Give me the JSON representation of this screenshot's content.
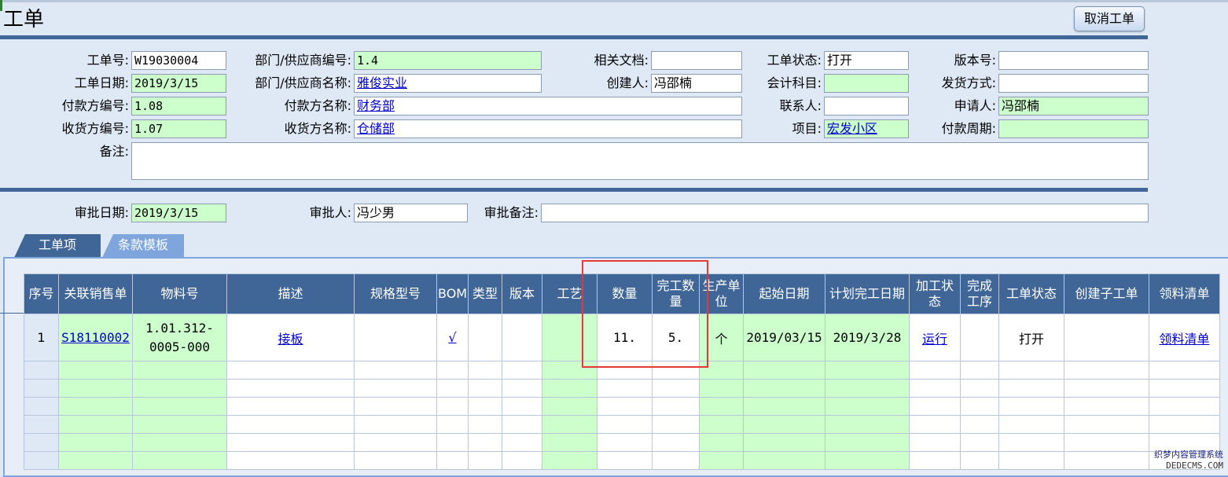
{
  "title": "工单",
  "cancel_button": "取消工单",
  "form": {
    "order_no": {
      "label": "工单号:",
      "value": "W19030004"
    },
    "order_date": {
      "label": "工单日期:",
      "value": "2019/3/15"
    },
    "payer_code": {
      "label": "付款方编号:",
      "value": "1.08"
    },
    "receiver_code": {
      "label": "收货方编号:",
      "value": "1.07"
    },
    "remarks": {
      "label": "备注:",
      "value": ""
    },
    "dept_code": {
      "label": "部门/供应商编号:",
      "value": "1.4"
    },
    "dept_name": {
      "label": "部门/供应商名称:",
      "value": "雅俊实业"
    },
    "payer_name": {
      "label": "付款方名称:",
      "value": "财务部"
    },
    "receiver_name": {
      "label": "收货方名称:",
      "value": "仓储部"
    },
    "related_docs": {
      "label": "相关文档:",
      "value": ""
    },
    "creator": {
      "label": "创建人:",
      "value": "冯邵楠"
    },
    "status": {
      "label": "工单状态:",
      "value": "打开"
    },
    "account": {
      "label": "会计科目:",
      "value": ""
    },
    "contact": {
      "label": "联系人:",
      "value": ""
    },
    "project": {
      "label": "项目:",
      "value": "宏发小区"
    },
    "version": {
      "label": "版本号:",
      "value": ""
    },
    "shipping": {
      "label": "发货方式:",
      "value": ""
    },
    "applicant": {
      "label": "申请人:",
      "value": "冯邵楠"
    },
    "pay_period": {
      "label": "付款周期:",
      "value": ""
    }
  },
  "approval": {
    "date": {
      "label": "审批日期:",
      "value": "2019/3/15"
    },
    "approver": {
      "label": "审批人:",
      "value": "冯少男"
    },
    "note": {
      "label": "审批备注:",
      "value": ""
    }
  },
  "tabs": [
    "工单项",
    "条款模板"
  ],
  "grid": {
    "headers": [
      "序号",
      "关联销售单",
      "物料号",
      "描述",
      "规格型号",
      "BOM",
      "类型",
      "版本",
      "工艺",
      "数量",
      "完工数量",
      "生产单位",
      "起始日期",
      "计划完工日期",
      "加工状态",
      "完成工序",
      "工单状态",
      "创建子工单",
      "领料清单"
    ],
    "row": {
      "seq": "1",
      "sales_order": "S18110002",
      "material": "1.01.312-0005-000",
      "description": "接板",
      "spec": "",
      "bom": "√",
      "type": "",
      "version": "",
      "process": "",
      "qty": "11.",
      "done_qty": "5.",
      "unit": "个",
      "start_date": "2019/03/15",
      "plan_date": "2019/3/28",
      "proc_status": "运行",
      "done_step": "",
      "status": "打开",
      "sub_order": "",
      "picking": "领料清单"
    }
  },
  "watermark": {
    "line1": "织梦内容管理系统",
    "line2": "DEDECMS.COM"
  }
}
